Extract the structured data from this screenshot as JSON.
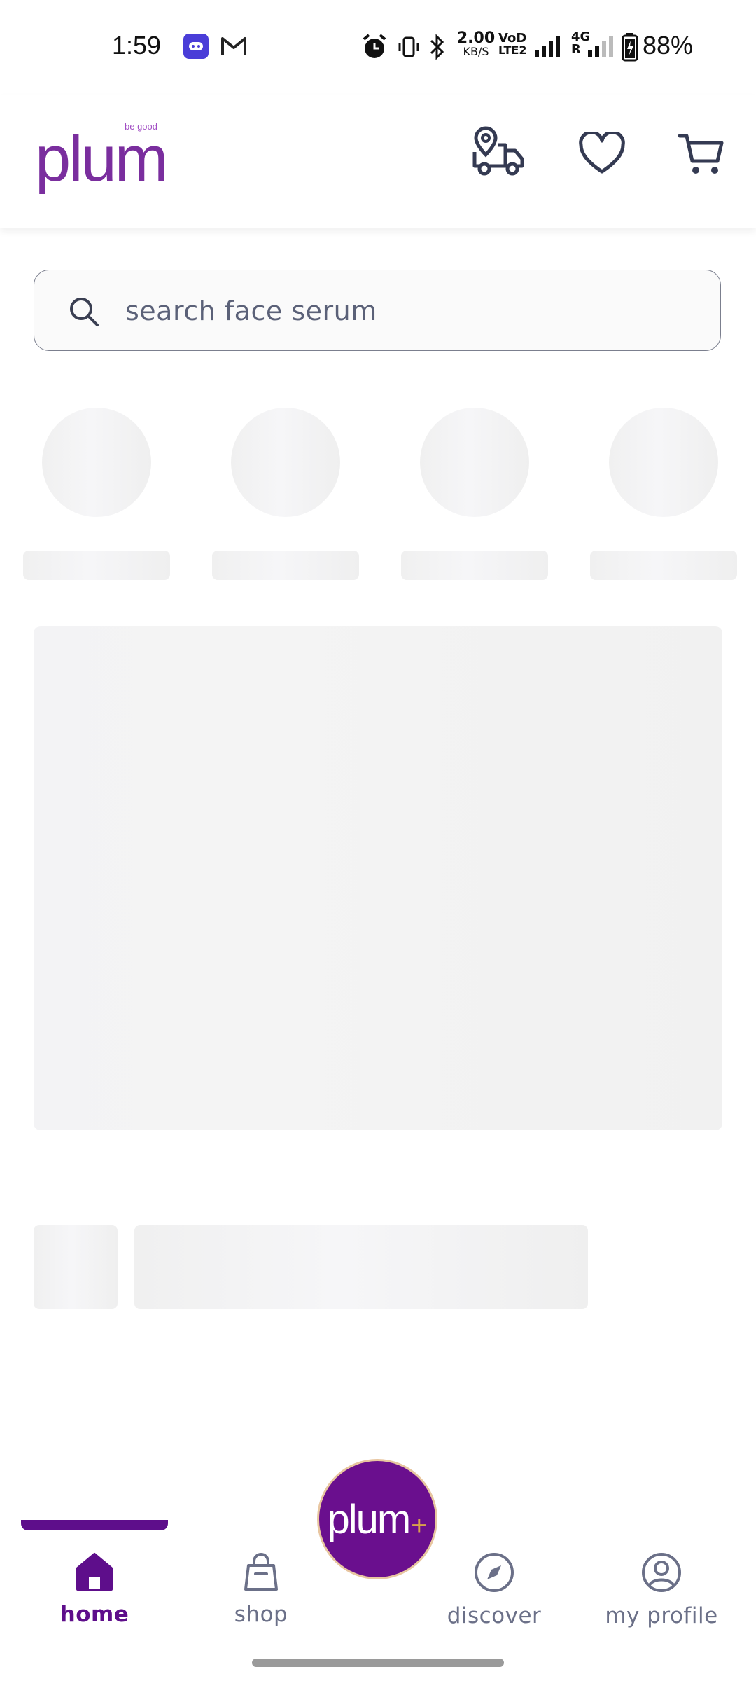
{
  "status_bar": {
    "time": "1:59",
    "net_speed": "2.00",
    "net_unit": "KB/S",
    "volte": "VoD",
    "lte": "LTE2",
    "network_type": "4G",
    "battery": "88%"
  },
  "header": {
    "logo_text": "plum",
    "logo_tagline": "be good",
    "icons": [
      "delivery-truck-icon",
      "heart-icon",
      "cart-icon"
    ]
  },
  "search": {
    "placeholder": "search face serum"
  },
  "bottom_nav": {
    "items": [
      {
        "label": "home",
        "icon": "home-icon",
        "active": true
      },
      {
        "label": "shop",
        "icon": "shopping-bag-icon",
        "active": false
      },
      {
        "label": "discover",
        "icon": "compass-icon",
        "active": false
      },
      {
        "label": "my profile",
        "icon": "profile-icon",
        "active": false
      }
    ],
    "center_button": {
      "text": "plum",
      "plus": "+"
    }
  },
  "colors": {
    "brand_purple": "#5e0e8b",
    "logo_purple": "#7a2e9e",
    "icon_dark": "#343a52",
    "skeleton": "#f1f1f1"
  }
}
